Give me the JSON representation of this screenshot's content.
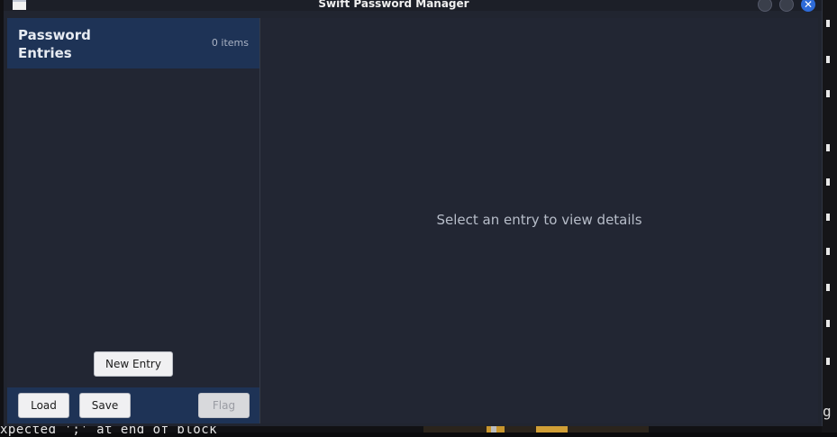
{
  "window": {
    "title": "Swift Password Manager"
  },
  "sidebar": {
    "title": "Password Entries",
    "count": "0 items",
    "new_entry_label": "New Entry",
    "footer": {
      "load_label": "Load",
      "save_label": "Save",
      "flag_label": "Flag"
    }
  },
  "main": {
    "placeholder": "Select an entry to view details"
  },
  "background": {
    "terminal_bottom_text": "xpected ';' at end of block",
    "terminal_right_char": "g"
  },
  "colors": {
    "accent": "#1e3356",
    "window_bg": "#222633",
    "close_button": "#2e6bd8"
  },
  "icons": {
    "app": "app-window-icon",
    "minimize": "minimize-icon",
    "maximize": "maximize-icon",
    "close": "close-icon"
  }
}
